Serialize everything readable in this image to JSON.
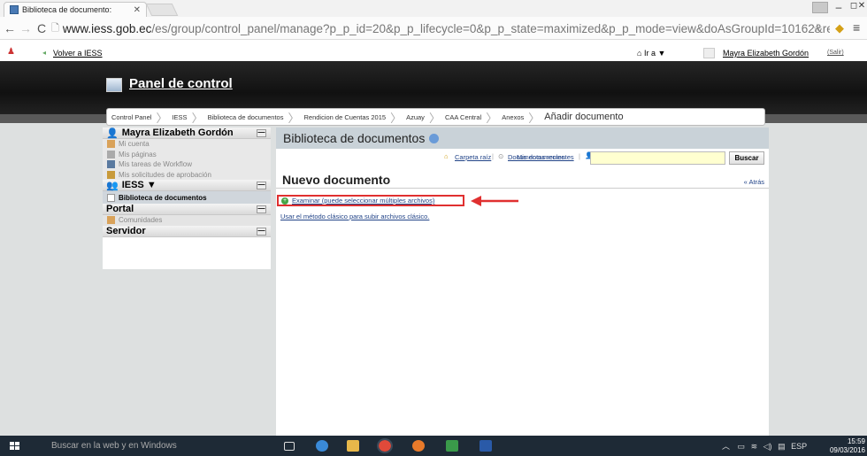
{
  "browser": {
    "tab_title": "Biblioteca de documento:",
    "url_domain": "www.iess.gob.ec",
    "url_rest": "/es/group/control_panel/manage?p_p_id=20&p_p_lifecycle=0&p_p_state=maximized&p_p_mode=view&doAsGroupId=10162&referer",
    "window_controls": [
      "–",
      "◻",
      "✕"
    ]
  },
  "dock": {
    "back_link": "Volver a IESS",
    "go_to": "Ir a ▼",
    "user_name": "Mayra Elizabeth Gordón",
    "logout": "(Salir)"
  },
  "header": {
    "title": "Panel de control"
  },
  "breadcrumb": [
    "Control Panel",
    "IESS",
    "Biblioteca de documentos",
    "Rendicion de Cuentas 2015",
    "Azuay",
    "CAA Central",
    "Anexos",
    "Añadir documento"
  ],
  "sidebar": {
    "user_section": {
      "title": "Mayra Elizabeth Gordón",
      "items": [
        "Mi cuenta",
        "Mis páginas",
        "Mis tareas de Workflow",
        "Mis solicitudes de aprobación"
      ]
    },
    "iess_section": {
      "title": "IESS ▼",
      "items": [
        "Biblioteca de documentos"
      ]
    },
    "portal_section": {
      "title": "Portal",
      "items": [
        "Comunidades"
      ]
    },
    "server_section": {
      "title": "Servidor"
    }
  },
  "portlet": {
    "title": "Biblioteca de documentos",
    "links": [
      "Carpeta raíz",
      "Documentos recientes",
      "Mis documentos"
    ],
    "search_button": "Buscar",
    "heading": "Nuevo documento",
    "back": "« Atrás",
    "examinar": "Examinar (puede seleccionar múltiples archivos)",
    "classic": "Usar el método clásico para subir archivos clásico."
  },
  "taskbar": {
    "search_placeholder": "Buscar en la web y en Windows",
    "lang": "ESP",
    "time": "15:59",
    "date": "09/03/2016"
  },
  "colors": {
    "highlight": "#e03030",
    "portlet_title_bg": "#c9d2d8",
    "link": "#224488"
  }
}
